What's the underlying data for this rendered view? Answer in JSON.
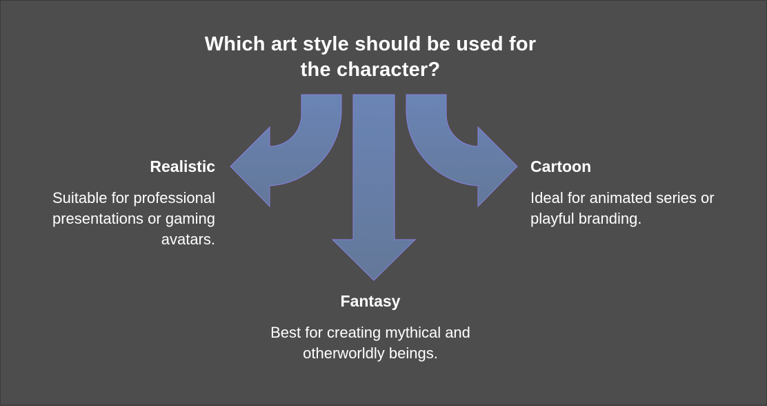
{
  "title": "Which art style should be used for the character?",
  "colors": {
    "background": "#4d4d4d",
    "arrow_fill": "#6880ad",
    "arrow_stroke": "#8a7fe0",
    "text": "#ffffff"
  },
  "options": {
    "realistic": {
      "title": "Realistic",
      "description": "Suitable for professional presentations or gaming avatars.",
      "direction": "left"
    },
    "fantasy": {
      "title": "Fantasy",
      "description": "Best for creating mythical and otherworldly beings.",
      "direction": "down"
    },
    "cartoon": {
      "title": "Cartoon",
      "description": "Ideal for animated series or playful branding.",
      "direction": "right"
    }
  }
}
